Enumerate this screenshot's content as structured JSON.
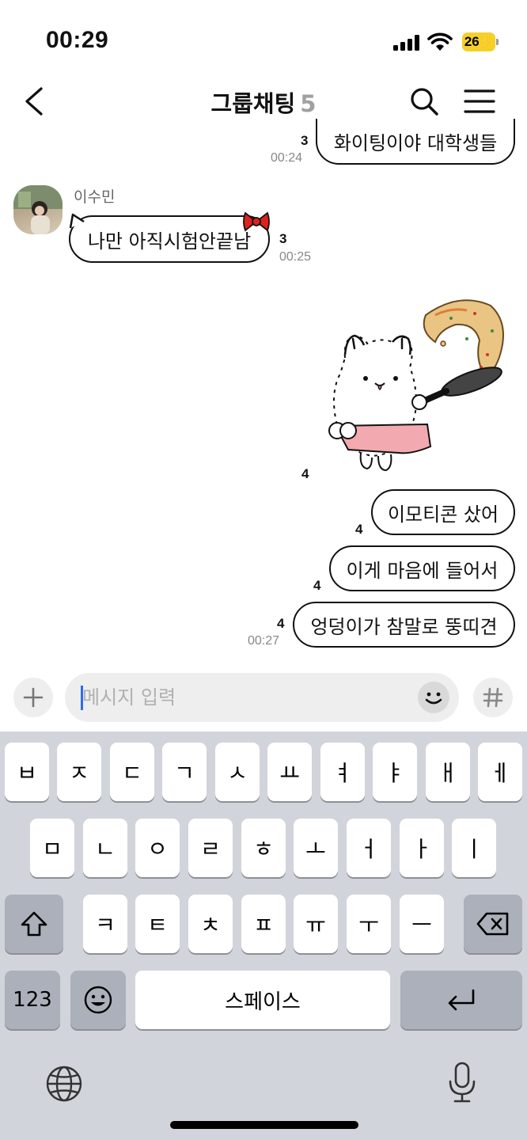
{
  "status_bar": {
    "time": "00:29",
    "battery": "26"
  },
  "header": {
    "title": "그룹채팅",
    "member_count": "5"
  },
  "messages": [
    {
      "text": "화이팅이야 대학생들",
      "unread": "3",
      "time": "00:24"
    },
    {
      "sender": "이수민",
      "text": "나만 아직시험안끝남",
      "unread": "3",
      "time": "00:25"
    },
    {
      "sticker": "cat-cooking-pancake-sticker",
      "unread": "4"
    },
    {
      "text": "이모티콘 샀어",
      "unread": "4"
    },
    {
      "text": "이게 마음에 들어서",
      "unread": "4"
    },
    {
      "text": "엉덩이가 참말로 뚱띠견",
      "unread": "4",
      "time": "00:27"
    }
  ],
  "input": {
    "placeholder": "메시지 입력"
  },
  "keyboard": {
    "row1": [
      "ㅂ",
      "ㅈ",
      "ㄷ",
      "ㄱ",
      "ㅅ",
      "ㅛ",
      "ㅕ",
      "ㅑ",
      "ㅐ",
      "ㅔ"
    ],
    "row2": [
      "ㅁ",
      "ㄴ",
      "ㅇ",
      "ㄹ",
      "ㅎ",
      "ㅗ",
      "ㅓ",
      "ㅏ",
      "ㅣ"
    ],
    "row3": [
      "ㅋ",
      "ㅌ",
      "ㅊ",
      "ㅍ",
      "ㅠ",
      "ㅜ",
      "ㅡ"
    ],
    "numbers_key": "123",
    "space_key": "스페이스"
  },
  "colors": {
    "battery": "#f5d02a",
    "caret": "#2d6cf0",
    "keyboard_bg": "#d1d4da"
  }
}
